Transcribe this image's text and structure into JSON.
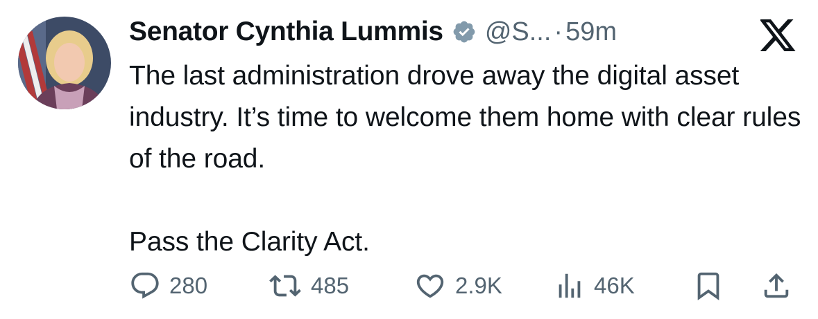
{
  "author": {
    "name": "Senator Cynthia Lummis",
    "handle": "@S...",
    "separator": "·",
    "time": "59m",
    "verified_icon": "verified-badge-icon",
    "avatar_icon": "profile-photo"
  },
  "tweet": {
    "paragraph_1": "The last administration drove away the digital asset industry. It’s time to welcome them home with clear rules of the road.",
    "paragraph_2": "Pass the Clarity Act."
  },
  "platform_logo": "x-logo-icon",
  "actions": {
    "replies": {
      "icon": "reply-icon",
      "count": "280"
    },
    "reposts": {
      "icon": "repost-icon",
      "count": "485"
    },
    "likes": {
      "icon": "like-icon",
      "count": "2.9K"
    },
    "views": {
      "icon": "views-icon",
      "count": "46K"
    },
    "bookmark": {
      "icon": "bookmark-icon"
    },
    "share": {
      "icon": "share-icon"
    }
  },
  "colors": {
    "text_primary": "#0f1419",
    "text_secondary": "#536471",
    "verified_badge": "#829aab"
  }
}
